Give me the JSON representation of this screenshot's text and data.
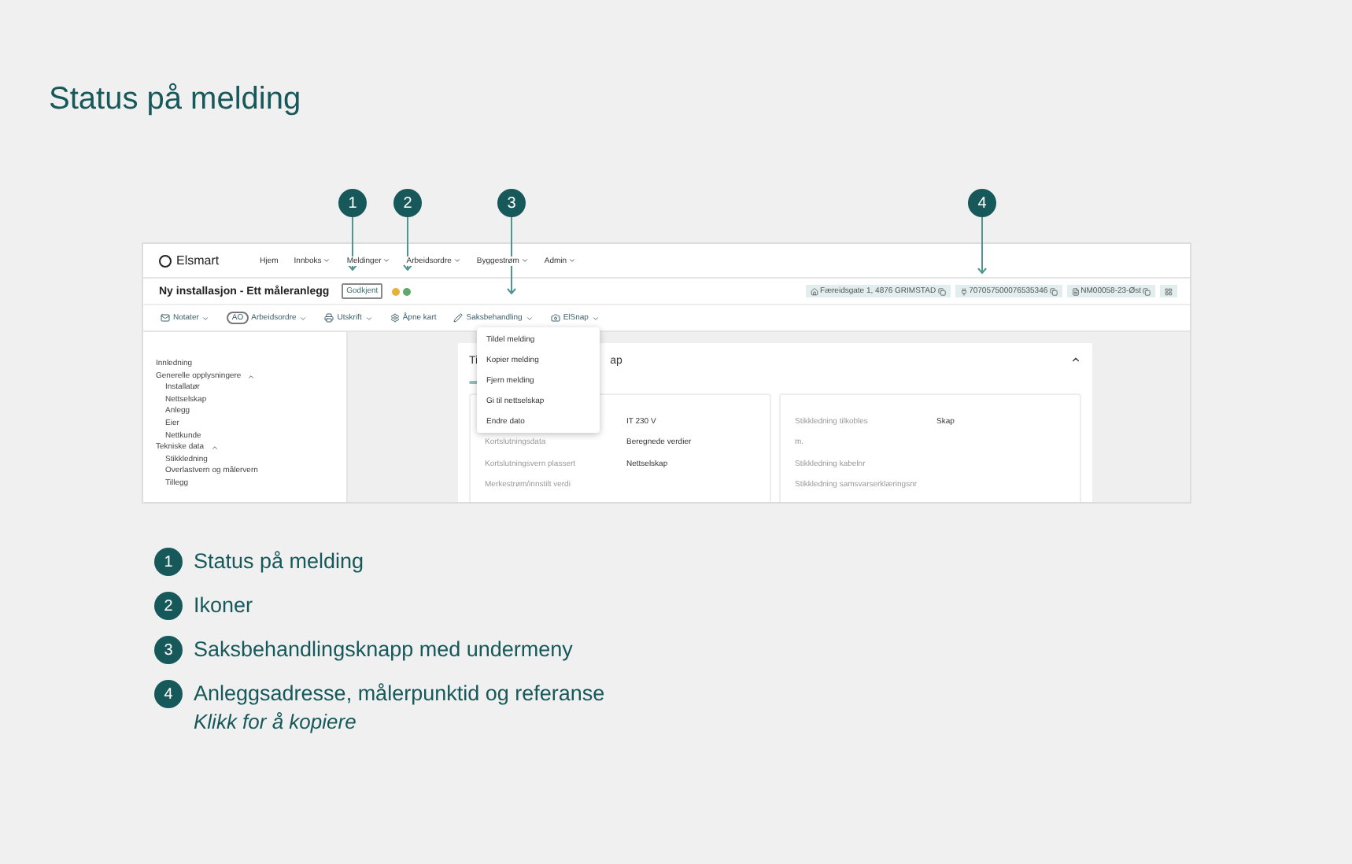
{
  "title": "Status på melding",
  "callouts": [
    {
      "number": "1"
    },
    {
      "number": "2"
    },
    {
      "number": "3"
    },
    {
      "number": "4"
    }
  ],
  "app": {
    "logo": "Elsmart",
    "nav": [
      {
        "label": "Hjem",
        "dropdown": false
      },
      {
        "label": "Innboks",
        "dropdown": true
      },
      {
        "label": "Meldinger",
        "dropdown": true
      },
      {
        "label": "Arbeidsordre",
        "dropdown": true
      },
      {
        "label": "Byggestrøm",
        "dropdown": true
      },
      {
        "label": "Admin",
        "dropdown": true
      }
    ],
    "page_title": "Ny installasjon - Ett måleranlegg",
    "status_badge": "Godkjent",
    "status_icons": [
      {
        "color": "#e6b23c"
      },
      {
        "color": "#5fa96c"
      }
    ],
    "info_chips": [
      {
        "kind": "address",
        "text": "Færeidsgate 1, 4876 GRIMSTAD",
        "copy": true
      },
      {
        "kind": "meter",
        "text": "707057500076535346",
        "copy": true
      },
      {
        "kind": "reference",
        "text": "NM00058-23-Øst",
        "copy": true
      },
      {
        "kind": "grid",
        "copy": false
      }
    ],
    "toolbar": [
      {
        "kind": "mail",
        "label": "Notater",
        "dropdown": true
      },
      {
        "kind": "badge",
        "badge": "AO",
        "label": "Arbeidsordre",
        "dropdown": true
      },
      {
        "kind": "printer",
        "label": "Utskrift",
        "dropdown": true
      },
      {
        "kind": "gear",
        "label": "Åpne kart",
        "dropdown": false
      },
      {
        "kind": "pencil",
        "label": "Saksbehandling",
        "dropdown": true
      },
      {
        "kind": "camera",
        "label": "ElSnap",
        "dropdown": true
      }
    ],
    "menu": [
      "Tildel melding",
      "Kopier melding",
      "Fjern melding",
      "Gi til nettselskap",
      "Endre dato"
    ],
    "sidebar": [
      {
        "label": "Innledning"
      },
      {
        "label": "Generelle opplysningere",
        "expanded": true,
        "children": [
          {
            "label": "Installatør"
          },
          {
            "label": "Nettselskap"
          },
          {
            "label": "Anlegg"
          },
          {
            "label": "Eier"
          },
          {
            "label": "Nettkunde"
          }
        ]
      },
      {
        "label": "Tekniske data",
        "expanded": true,
        "children": [
          {
            "label": "Stikkledning"
          },
          {
            "label": "Overlastvern og målervern"
          },
          {
            "label": "Tillegg"
          }
        ]
      }
    ],
    "card": {
      "title_start": "Ti",
      "title_end": "ap",
      "expanded": true,
      "left_fields": [
        {
          "value": "IT 230 V"
        },
        {
          "label": "Kortslutningsdata",
          "value": "Beregnede verdier"
        },
        {
          "label": "Kortslutningsvern plassert",
          "value": "Nettselskap"
        },
        {
          "label": "Merkestrøm/innstilt verdi"
        }
      ],
      "right_fields": [
        {
          "label": "Stikkledning tilkobles",
          "value": "Skap"
        },
        {
          "label": "m."
        },
        {
          "label": "Stikkledning kabelnr"
        },
        {
          "label": "Stikkledning samsvarserklæringsnr"
        }
      ]
    }
  },
  "legend": [
    {
      "number": "1",
      "text": "Status på melding"
    },
    {
      "number": "2",
      "text": "Ikoner"
    },
    {
      "number": "3",
      "text": "Saksbehandlingsknapp med undermeny"
    },
    {
      "number": "4",
      "text": "Anleggsadresse, målerpunktid og referanse",
      "note": "Klikk for å kopiere"
    }
  ]
}
